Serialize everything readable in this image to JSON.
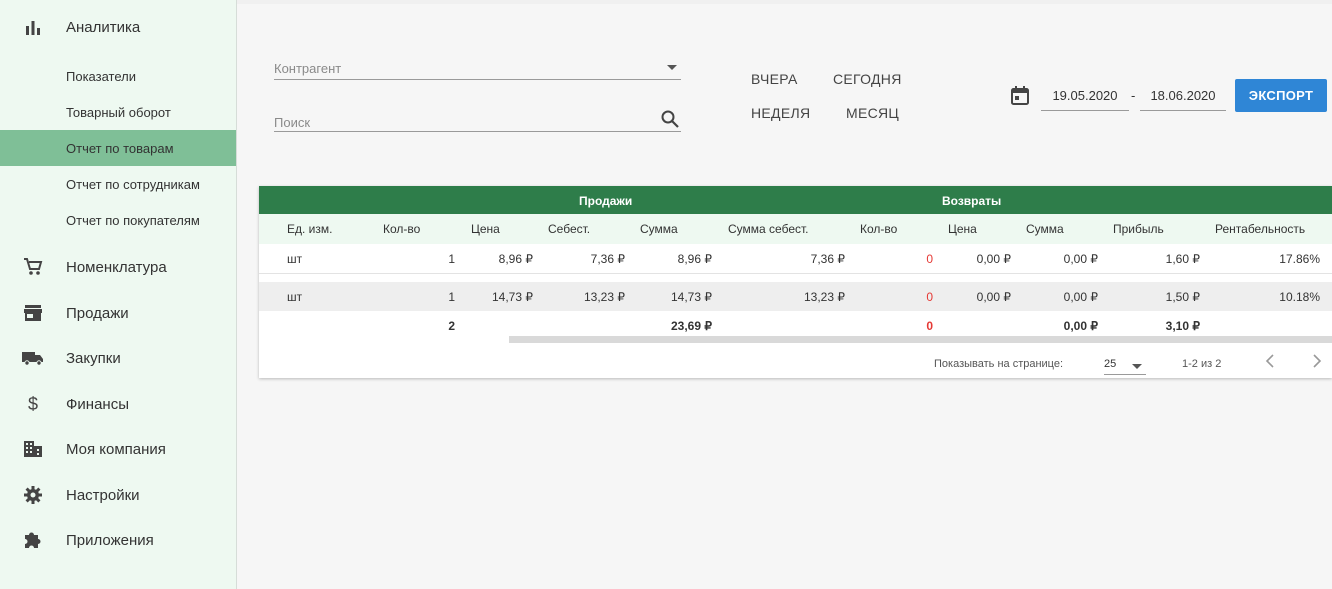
{
  "sidebar": {
    "analytics": "Аналитика",
    "sub": [
      "Показатели",
      "Товарный оборот",
      "Отчет по товарам",
      "Отчет по сотрудникам",
      "Отчет по покупателям"
    ],
    "items": [
      "Номенклатура",
      "Продажи",
      "Закупки",
      "Финансы",
      "Моя компания",
      "Настройки",
      "Приложения"
    ]
  },
  "filters": {
    "counterparty_placeholder": "Контрагент",
    "search_placeholder": "Поиск",
    "quick": [
      "ВЧЕРА",
      "СЕГОДНЯ",
      "НЕДЕЛЯ",
      "МЕСЯЦ"
    ],
    "date_from": "19.05.2020",
    "date_sep": "-",
    "date_to": "18.06.2020",
    "export_label": "ЭКСПОРТ"
  },
  "table": {
    "group_sales": "Продажи",
    "group_returns": "Возвраты",
    "columns": [
      "Ед. изм.",
      "Кол-во",
      "Цена",
      "Себест.",
      "Сумма",
      "Сумма себест.",
      "Кол-во",
      "Цена",
      "Сумма",
      "Прибыль",
      "Рентабельность"
    ],
    "rows": [
      [
        "шт",
        "1",
        "8,96 ₽",
        "7,36 ₽",
        "8,96 ₽",
        "7,36 ₽",
        "0",
        "0,00 ₽",
        "0,00 ₽",
        "1,60 ₽",
        "17.86%"
      ],
      [
        "шт",
        "1",
        "14,73 ₽",
        "13,23 ₽",
        "14,73 ₽",
        "13,23 ₽",
        "0",
        "0,00 ₽",
        "0,00 ₽",
        "1,50 ₽",
        "10.18%"
      ]
    ],
    "totals": {
      "qty": "2",
      "sum": "23,69 ₽",
      "ret_qty": "0",
      "ret_sum": "0,00 ₽",
      "profit": "3,10 ₽"
    },
    "footer": {
      "per_page_label": "Показывать на странице:",
      "per_page": "25",
      "range": "1-2 из 2"
    }
  },
  "colors": {
    "accent": "#2e7d4a",
    "active_nav": "#7fbf97",
    "button": "#2f86d6",
    "negative": "#e53935"
  }
}
